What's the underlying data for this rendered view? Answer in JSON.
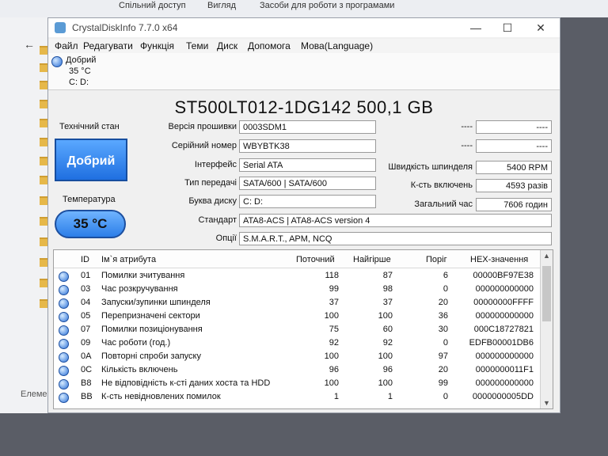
{
  "ribbon": {
    "items": [
      "Спільний доступ",
      "Вигляд",
      "Засоби для роботи з програмами"
    ]
  },
  "explorer": {
    "status_text": "Елеме"
  },
  "window": {
    "title": "CrystalDiskInfo 7.7.0 x64",
    "menu": [
      "Файл",
      "Редагувати",
      "Функція",
      "Теми",
      "Диск",
      "Допомога",
      "Мова(Language)"
    ],
    "disk_tab": {
      "status": "Добрий",
      "temp": "35 °C",
      "letter": "C: D:"
    }
  },
  "drive": {
    "model": "ST500LT012-1DG142 500,1 GB",
    "health_label": "Технічний стан",
    "health_value": "Добрий",
    "temp_label": "Температура",
    "temp_value": "35 °C",
    "left_fields": [
      {
        "label": "Версія прошивки",
        "value": "0003SDM1"
      },
      {
        "label": "Серійний номер",
        "value": "WBYBTK38"
      },
      {
        "label": "Інтерфейс",
        "value": "Serial ATA"
      },
      {
        "label": "Тип передачі",
        "value": "SATA/600 | SATA/600"
      },
      {
        "label": "Буква диску",
        "value": "C: D:"
      }
    ],
    "wide_fields": [
      {
        "label": "Стандарт",
        "value": "ATA8-ACS | ATA8-ACS version 4"
      },
      {
        "label": "Опції",
        "value": "S.M.A.R.T., APM, NCQ"
      }
    ],
    "right_fields": [
      {
        "label": "----",
        "value": "----"
      },
      {
        "label": "----",
        "value": "----"
      },
      {
        "label": "Швидкість шпинделя",
        "value": "5400 RPM"
      },
      {
        "label": "К-сть включень",
        "value": "4593 разів"
      },
      {
        "label": "Загальний час",
        "value": "7606 годин"
      }
    ]
  },
  "smart": {
    "headers": [
      "ID",
      "Ім`я атрибута",
      "Поточний",
      "Найгірше",
      "Поріг",
      "HEX-значення"
    ],
    "rows": [
      {
        "id": "01",
        "name": "Помилки зчитування",
        "current": "118",
        "worst": "87",
        "threshold": "6",
        "raw": "00000BF97E38"
      },
      {
        "id": "03",
        "name": "Час розкручування",
        "current": "99",
        "worst": "98",
        "threshold": "0",
        "raw": "000000000000"
      },
      {
        "id": "04",
        "name": "Запуски/зупинки шпинделя",
        "current": "37",
        "worst": "37",
        "threshold": "20",
        "raw": "00000000FFFF"
      },
      {
        "id": "05",
        "name": "Перепризначені сектори",
        "current": "100",
        "worst": "100",
        "threshold": "36",
        "raw": "000000000000"
      },
      {
        "id": "07",
        "name": "Помилки позиціонування",
        "current": "75",
        "worst": "60",
        "threshold": "30",
        "raw": "000C18727821"
      },
      {
        "id": "09",
        "name": "Час роботи (год.)",
        "current": "92",
        "worst": "92",
        "threshold": "0",
        "raw": "EDFB00001DB6"
      },
      {
        "id": "0A",
        "name": "Повторні спроби запуску",
        "current": "100",
        "worst": "100",
        "threshold": "97",
        "raw": "000000000000"
      },
      {
        "id": "0C",
        "name": "Кількість включень",
        "current": "96",
        "worst": "96",
        "threshold": "20",
        "raw": "0000000011F1"
      },
      {
        "id": "B8",
        "name": "Не відповідність к-сті даних хоста та HDD",
        "current": "100",
        "worst": "100",
        "threshold": "99",
        "raw": "000000000000"
      },
      {
        "id": "BB",
        "name": "К-сть невідновлених помилок",
        "current": "1",
        "worst": "1",
        "threshold": "0",
        "raw": "0000000005DD"
      }
    ]
  },
  "colors": {
    "good": "#2b74e4",
    "accent": "#1d4fa0"
  }
}
